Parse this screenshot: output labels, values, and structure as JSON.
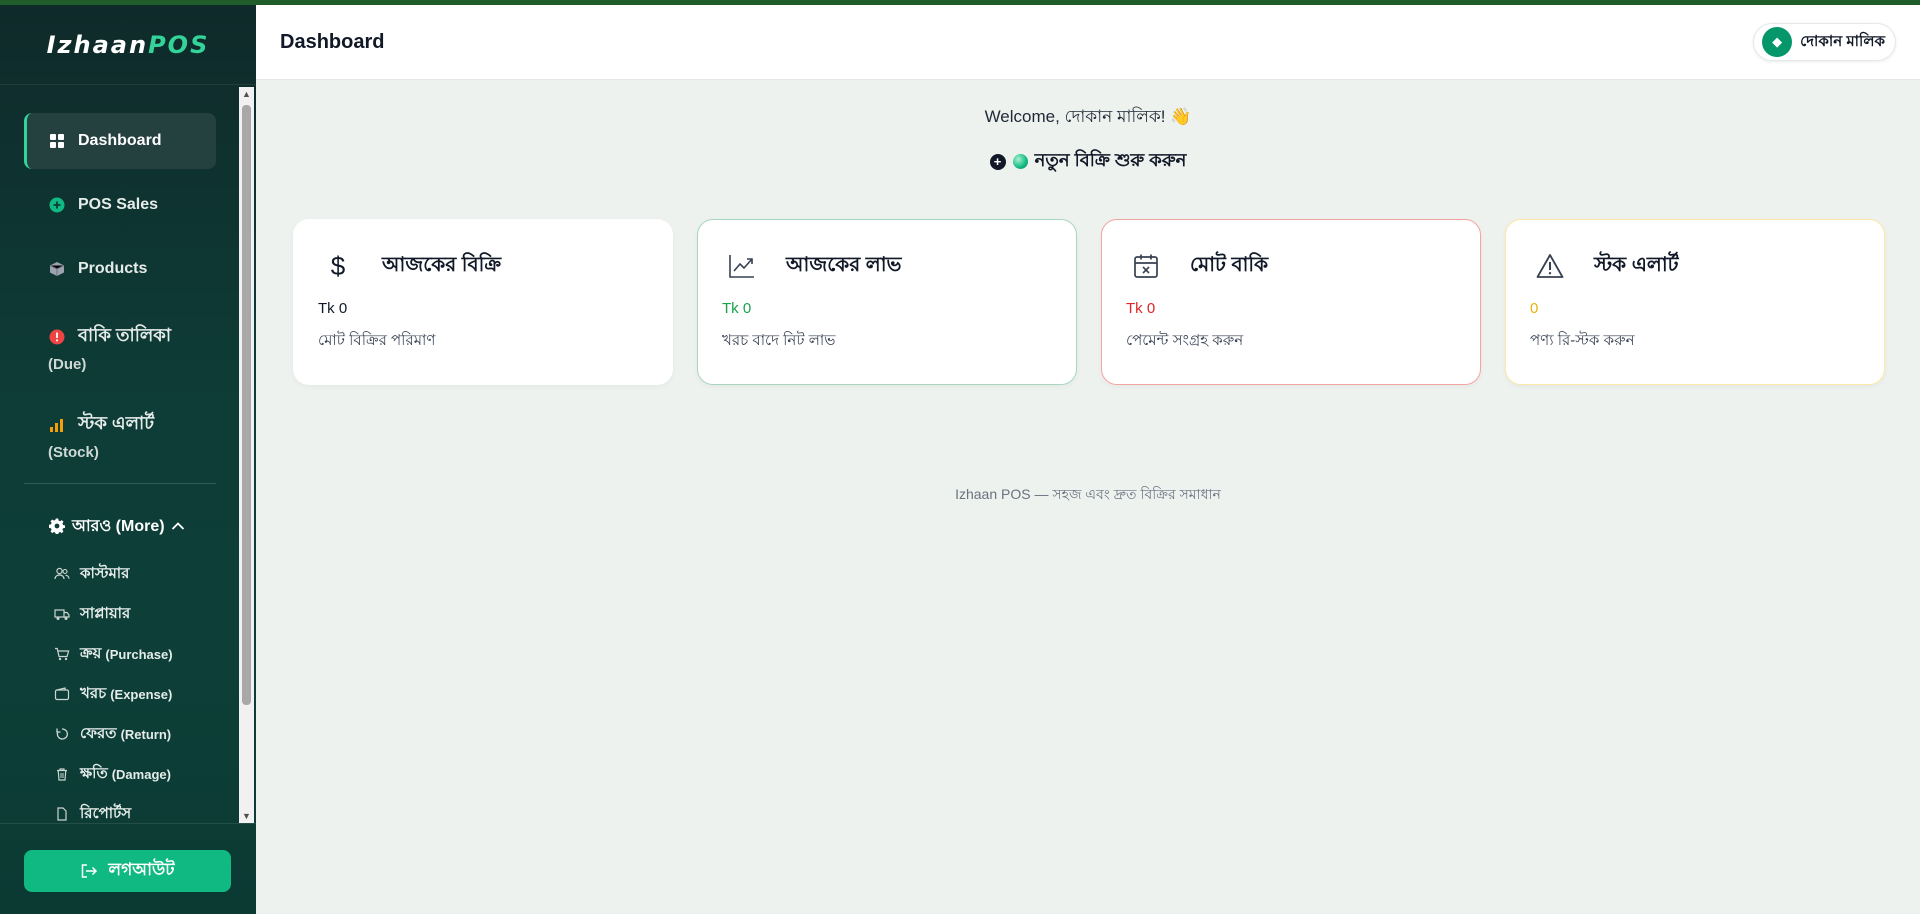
{
  "brand": {
    "part1": "Izhaan",
    "part2": "POS"
  },
  "sidebar": {
    "items": [
      {
        "label": "Dashboard",
        "icon": "grid-icon"
      },
      {
        "label": "POS Sales",
        "icon": "plus-circle-icon"
      },
      {
        "label": "Products",
        "icon": "box-icon"
      },
      {
        "label": "বাকি তালিকা",
        "sub": "(Due)",
        "icon": "alert-circle-icon"
      },
      {
        "label": "স্টক এলার্ট",
        "sub": "(Stock)",
        "icon": "bar-chart-icon"
      }
    ],
    "more_label": "আরও (More)",
    "sub_items": [
      {
        "label": "কাস্টমার",
        "suffix": ""
      },
      {
        "label": "সাপ্লায়ার",
        "suffix": ""
      },
      {
        "label": "ক্রয়",
        "suffix": "(Purchase)"
      },
      {
        "label": "খরচ",
        "suffix": "(Expense)"
      },
      {
        "label": "ফেরত",
        "suffix": "(Return)"
      },
      {
        "label": "ক্ষতি",
        "suffix": "(Damage)"
      },
      {
        "label": "রিপোর্টস",
        "suffix": ""
      }
    ],
    "logout_label": "লগআউট"
  },
  "header": {
    "title": "Dashboard",
    "user_name": "দোকান মালিক",
    "avatar_glyph": "◆"
  },
  "main": {
    "welcome": "Welcome, দোকান মালিক! 👋",
    "new_sale_label": "নতুন বিক্রি শুরু করুন",
    "cards": [
      {
        "title": "আজকের বিক্রি",
        "value": "Tk 0",
        "desc": "মোট বিক্রির পরিমাণ",
        "icon": "dollar-icon",
        "accent": "#111827"
      },
      {
        "title": "আজকের লাভ",
        "value": "Tk 0",
        "desc": "খরচ বাদে নিট লাভ",
        "icon": "trending-up-icon",
        "accent": "#16a34a"
      },
      {
        "title": "মোট বাকি",
        "value": "Tk 0",
        "desc": "পেমেন্ট সংগ্রহ করুন",
        "icon": "calendar-x-icon",
        "accent": "#dc2626"
      },
      {
        "title": "স্টক এলার্ট",
        "value": "0",
        "desc": "পণ্য রি-স্টক করুন",
        "icon": "warning-icon",
        "accent": "#eab308"
      }
    ],
    "footer": "Izhaan POS — সহজ এবং দ্রুত বিক্রির সমাধান"
  },
  "colors": {
    "primary": "#10b981",
    "topline": "#1f5e2a",
    "background": "#eef2ee",
    "sidebar_dark": "#0e3b36"
  }
}
